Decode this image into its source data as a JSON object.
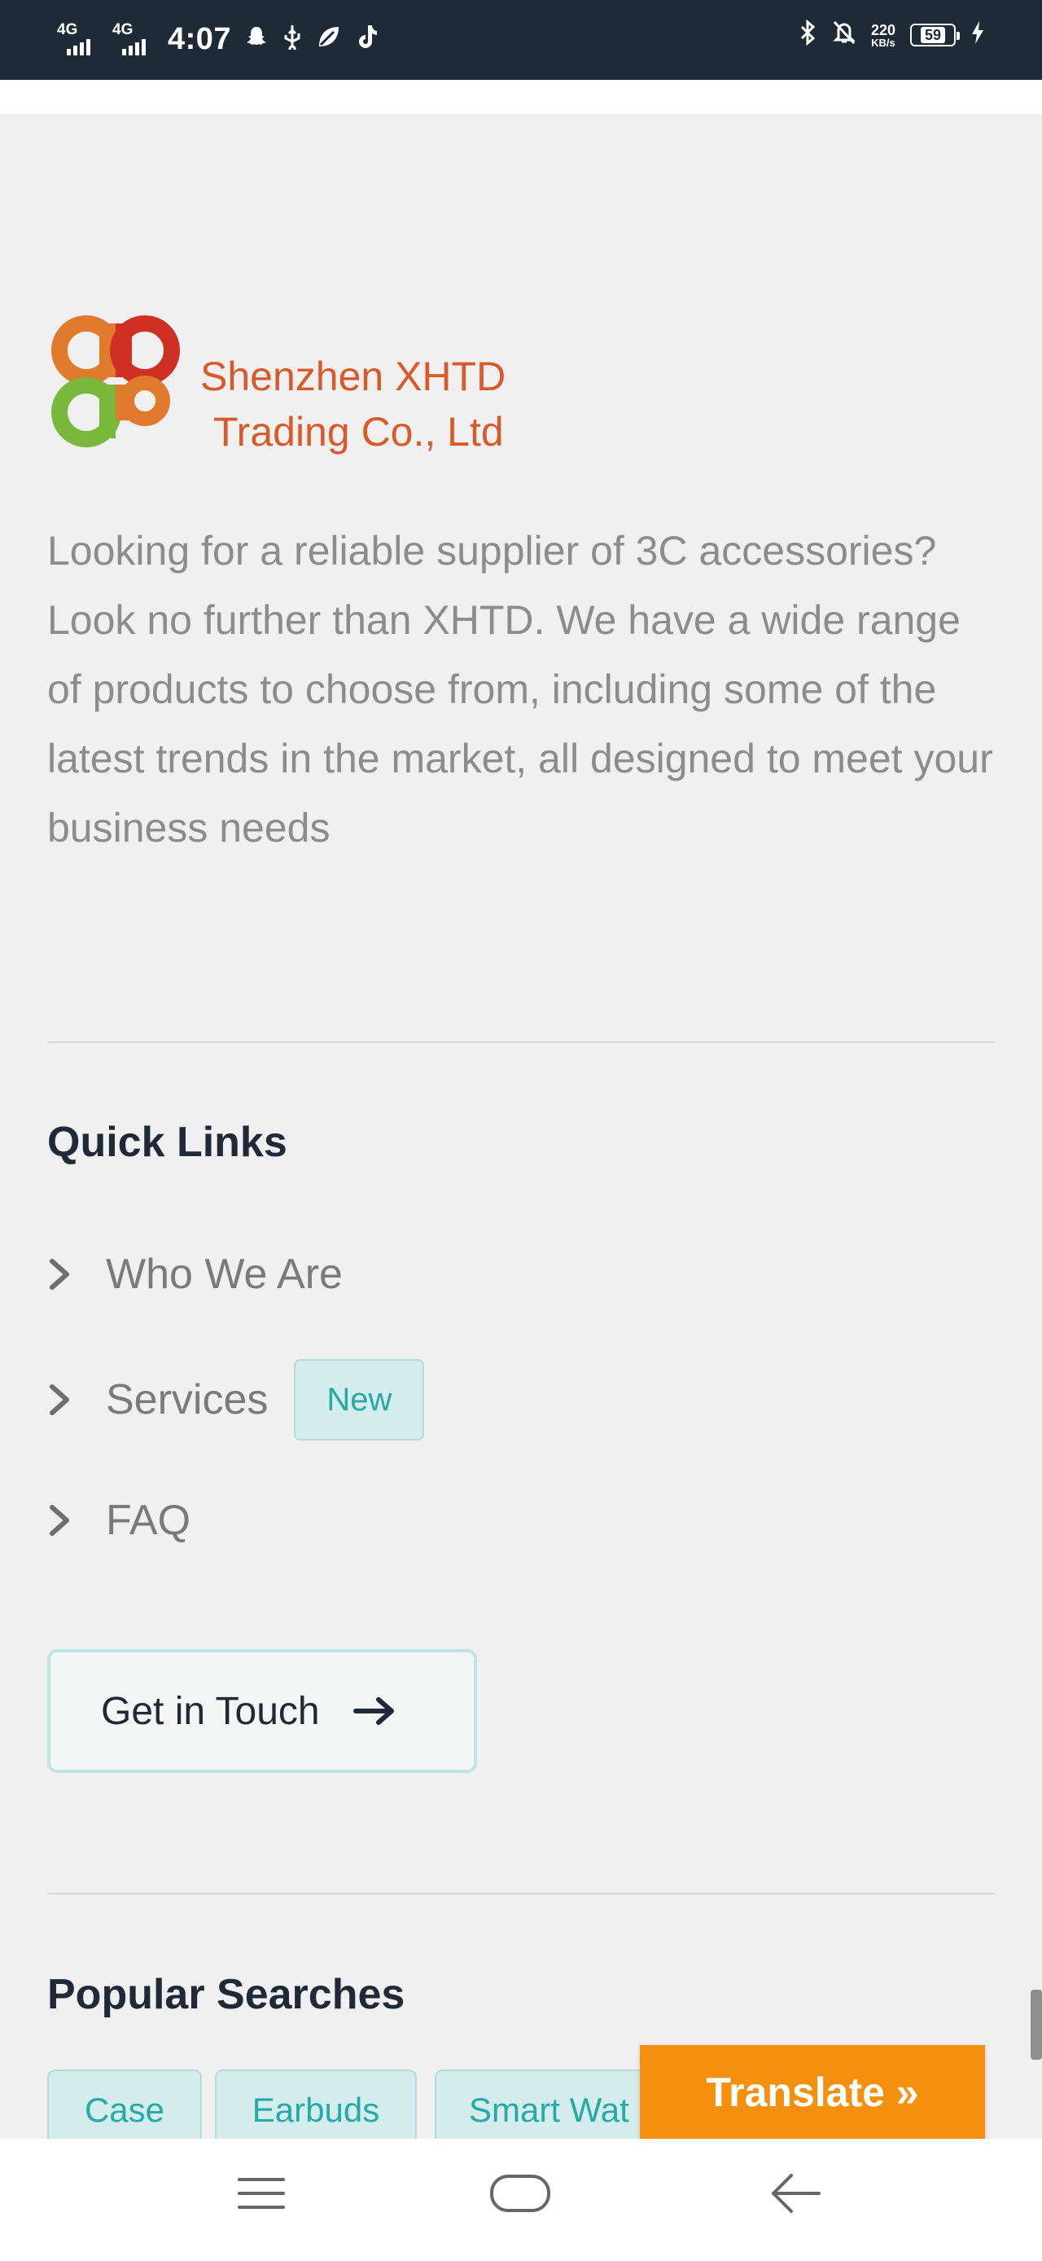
{
  "status_bar": {
    "net1": "4G",
    "net2": "4G",
    "time": "4:07",
    "speed_value": "220",
    "speed_unit": "KB/s",
    "battery": "59",
    "icons": [
      "snapchat-icon",
      "usb-icon",
      "leaf-icon",
      "tiktok-icon",
      "bluetooth-icon",
      "mute-icon",
      "charging-icon"
    ]
  },
  "brand": {
    "line1": "Shenzhen XHTD",
    "line2": "Trading Co., Ltd",
    "colors": {
      "orange": "#e07a2c",
      "red": "#cf3024",
      "green": "#7ab83c",
      "text": "#d85a2a"
    }
  },
  "description": "Looking for a reliable supplier of 3C accessories? Look no further than XHTD. We have a wide range of products to choose from, including some of the latest trends in the market, all designed to meet your business needs",
  "quick_links": {
    "heading": "Quick Links",
    "items": [
      {
        "label": "Who We Are"
      },
      {
        "label": "Services",
        "badge": "New"
      },
      {
        "label": "FAQ"
      }
    ]
  },
  "cta": {
    "label": "Get in Touch"
  },
  "popular_searches": {
    "heading": "Popular Searches",
    "tags": [
      "Case",
      "Earbuds",
      "Smart Wat"
    ]
  },
  "translate": {
    "label": "Translate »"
  },
  "accent": "#26a9a9"
}
